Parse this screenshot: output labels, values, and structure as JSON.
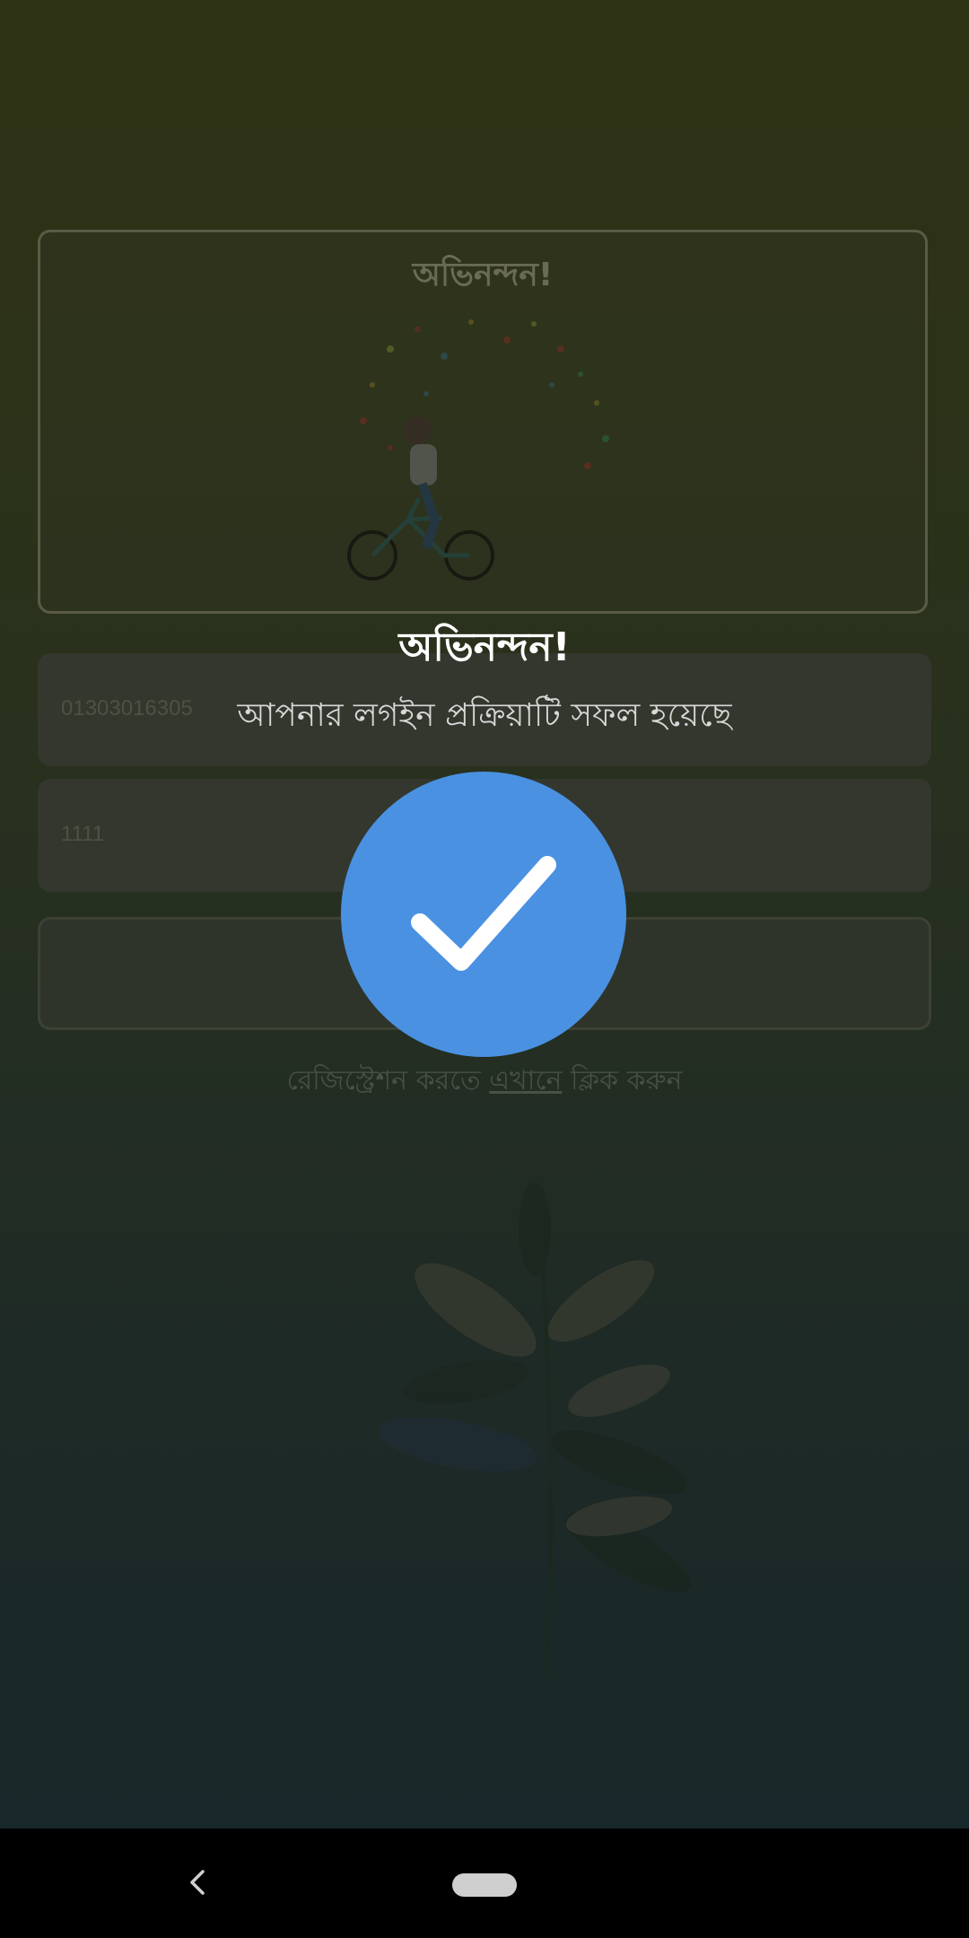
{
  "card": {
    "title": "অভিনন্দন!"
  },
  "phone_field": {
    "value": "01303016305"
  },
  "pin_field": {
    "value": "1111"
  },
  "register": {
    "prefix": "রেজিস্ট্রেশন করতে ",
    "link": "এখানে",
    "suffix": " ক্লিক করুন"
  },
  "dialog": {
    "title": "অভিনন্দন!",
    "message": "আপনার লগইন প্রক্রিয়াটি সফল হয়েছে",
    "icon": "check-icon",
    "accent": "#4a91e2"
  },
  "navbar": {
    "back_icon": "back-icon",
    "home_icon": "home-pill"
  }
}
